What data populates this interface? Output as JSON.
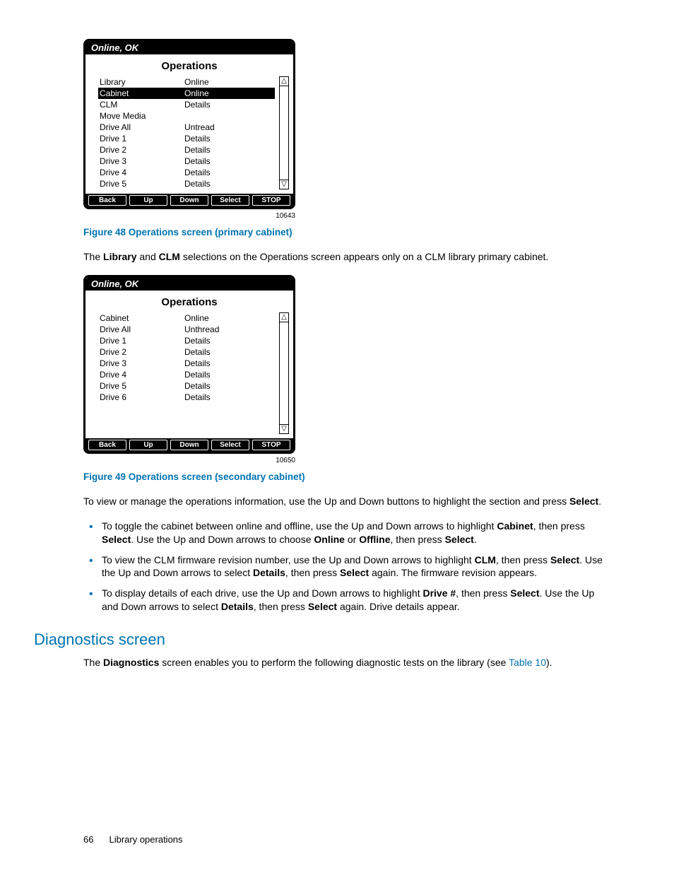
{
  "screen1": {
    "status": "Online, OK",
    "title": "Operations",
    "rows": [
      {
        "c1": "Library",
        "c2": "Online",
        "sel": false
      },
      {
        "c1": "Cabinet",
        "c2": "Online",
        "sel": true
      },
      {
        "c1": "CLM",
        "c2": "Details",
        "sel": false
      },
      {
        "c1": "Move Media",
        "c2": "",
        "sel": false
      },
      {
        "c1": "Drive All",
        "c2": "Untread",
        "sel": false
      },
      {
        "c1": "Drive 1",
        "c2": "Details",
        "sel": false
      },
      {
        "c1": "Drive 2",
        "c2": "Details",
        "sel": false
      },
      {
        "c1": "Drive 3",
        "c2": "Details",
        "sel": false
      },
      {
        "c1": "Drive 4",
        "c2": "Details",
        "sel": false
      },
      {
        "c1": "Drive 5",
        "c2": "Details",
        "sel": false
      }
    ],
    "buttons": [
      "Back",
      "Up",
      "Down",
      "Select",
      "STOP"
    ],
    "code": "10643"
  },
  "fig48": "Figure 48 Operations screen (primary cabinet)",
  "para1": {
    "pre": "The ",
    "b1": "Library",
    "mid": " and ",
    "b2": "CLM",
    "post": " selections on the Operations screen appears only on a CLM library primary cabinet."
  },
  "screen2": {
    "status": "Online, OK",
    "title": "Operations",
    "rows": [
      {
        "c1": "Cabinet",
        "c2": "Online"
      },
      {
        "c1": "Drive All",
        "c2": "Unthread"
      },
      {
        "c1": "Drive 1",
        "c2": "Details"
      },
      {
        "c1": "Drive 2",
        "c2": "Details"
      },
      {
        "c1": "Drive 3",
        "c2": "Details"
      },
      {
        "c1": "Drive 4",
        "c2": "Details"
      },
      {
        "c1": "Drive 5",
        "c2": "Details"
      },
      {
        "c1": "Drive 6",
        "c2": "Details"
      }
    ],
    "buttons": [
      "Back",
      "Up",
      "Down",
      "Select",
      "STOP"
    ],
    "code": "10650"
  },
  "fig49": "Figure 49 Operations screen (secondary cabinet)",
  "para2": {
    "t1": "To view or manage the operations information, use the Up and Down buttons to highlight the section and press ",
    "b1": "Select",
    "t2": "."
  },
  "bullets": {
    "li1": {
      "t1": "To toggle the cabinet between online and offline, use the Up and Down arrows to highlight ",
      "b1": "Cabinet",
      "t2": ", then press ",
      "b2": "Select",
      "t3": ". Use the Up and Down arrows to choose ",
      "b3": "Online",
      "t4": " or ",
      "b4": "Offline",
      "t5": ", then press ",
      "b5": "Select",
      "t6": "."
    },
    "li2": {
      "t1": "To view the CLM firmware revision number, use the Up and Down arrows to highlight ",
      "b1": "CLM",
      "t2": ", then press ",
      "b2": "Select",
      "t3": ". Use the Up and Down arrows to select ",
      "b3": "Details",
      "t4": ", then press ",
      "b4": "Select",
      "t5": " again. The firmware revision appears."
    },
    "li3": {
      "t1": "To display details of each drive, use the Up and Down arrows to highlight ",
      "b1": "Drive #",
      "t2": ", then press ",
      "b2": "Select",
      "t3": ". Use the Up and Down arrows to select ",
      "b3": "Details",
      "t4": ", then press ",
      "b4": "Select",
      "t5": " again. Drive details appear."
    }
  },
  "h2": "Diagnostics screen",
  "para3": {
    "t1": "The ",
    "b1": "Diagnostics",
    "t2": " screen enables you to perform the following diagnostic tests on the library (see ",
    "link": "Table 10",
    "t3": ")."
  },
  "footer": {
    "page": "66",
    "section": "Library operations"
  }
}
